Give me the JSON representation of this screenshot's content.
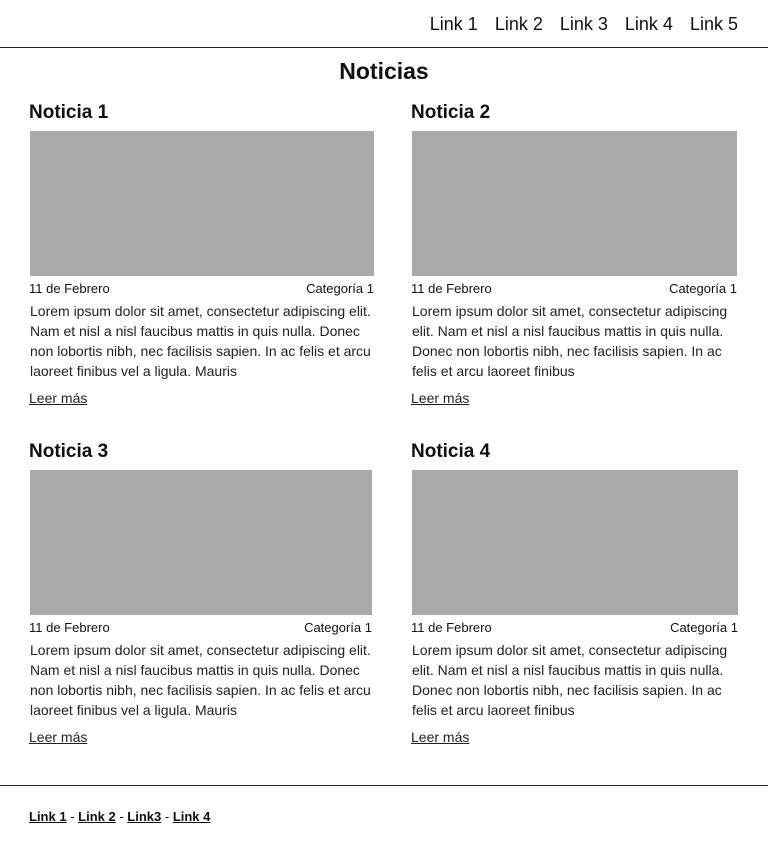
{
  "nav": {
    "links": [
      "Link 1",
      "Link 2",
      "Link 3",
      "Link 4",
      "Link 5"
    ]
  },
  "page": {
    "title": "Noticias"
  },
  "cards": [
    {
      "title": "Noticia 1",
      "date": "11 de Febrero",
      "category": "Categoría 1",
      "excerpt": "Lorem ipsum dolor sit amet, consectetur adipiscing elit. Nam et nisl a nisl faucibus mattis in quis nulla. Donec non lobortis nibh, nec facilisis sapien. In ac felis et arcu laoreet finibus vel a ligula. Mauris",
      "read_more": "Leer más"
    },
    {
      "title": "Noticia 2",
      "date": "11 de Febrero",
      "category": "Categoría 1",
      "excerpt": "Lorem ipsum dolor sit amet, consectetur adipiscing elit. Nam et nisl a nisl faucibus mattis in quis nulla. Donec non lobortis nibh, nec facilisis sapien. In ac felis et arcu laoreet finibus",
      "read_more": "Leer más"
    },
    {
      "title": "Noticia 3",
      "date": "11 de Febrero",
      "category": "Categoría 1",
      "excerpt": "Lorem ipsum dolor sit amet, consectetur adipiscing elit. Nam et nisl a nisl faucibus mattis in quis nulla. Donec non lobortis nibh, nec facilisis sapien. In ac felis et arcu laoreet finibus vel a ligula. Mauris",
      "read_more": "Leer más"
    },
    {
      "title": "Noticia 4",
      "date": "11 de Febrero",
      "category": "Categoría 1",
      "excerpt": "Lorem ipsum dolor sit amet, consectetur adipiscing elit. Nam et nisl a nisl faucibus mattis in quis nulla. Donec non lobortis nibh, nec facilisis sapien. In ac felis et arcu laoreet finibus",
      "read_more": "Leer más"
    }
  ],
  "footer": {
    "links": [
      "Link 1",
      "Link 2",
      "Link3",
      "Link 4"
    ],
    "separator": " - "
  },
  "colors": {
    "image_placeholder": "#aaaaaa",
    "text": "#111111",
    "divider": "#222222"
  }
}
